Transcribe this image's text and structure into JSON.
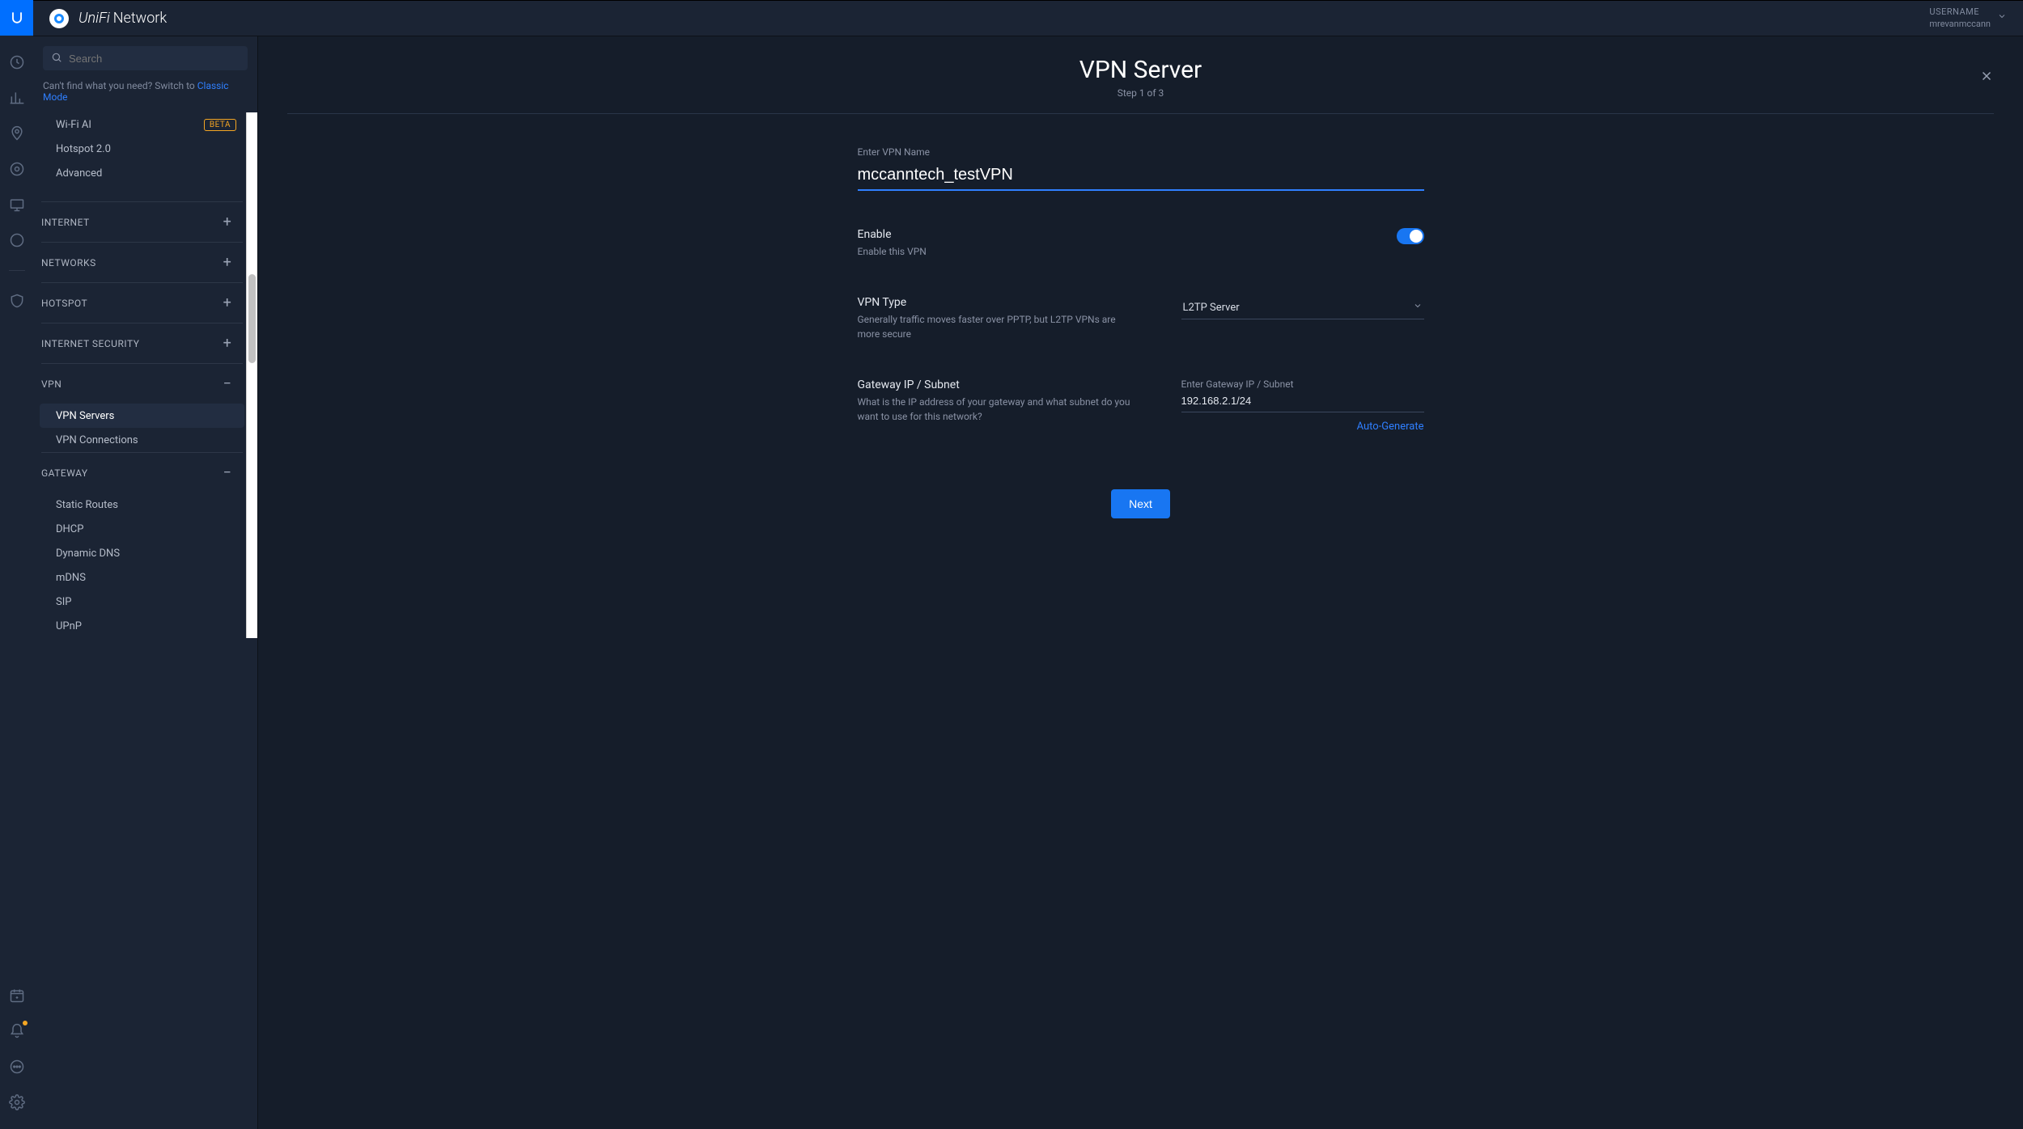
{
  "header": {
    "brand_unifi": "UniFi",
    "brand_network": "Network",
    "username_label": "USERNAME",
    "username_value": "mrevanmccann"
  },
  "sidebar": {
    "search_placeholder": "Search",
    "hint_prefix": "Can't find what you need? Switch to ",
    "hint_link": "Classic Mode",
    "top_items": [
      {
        "label": "Wi-Fi AI",
        "badge": "BETA"
      },
      {
        "label": "Hotspot 2.0"
      },
      {
        "label": "Advanced"
      }
    ],
    "sections": [
      {
        "label": "INTERNET",
        "action": "plus"
      },
      {
        "label": "NETWORKS",
        "action": "plus"
      },
      {
        "label": "HOTSPOT",
        "action": "plus"
      },
      {
        "label": "INTERNET SECURITY",
        "action": "plus"
      },
      {
        "label": "VPN",
        "action": "minus",
        "items": [
          {
            "label": "VPN Servers",
            "active": true
          },
          {
            "label": "VPN Connections"
          }
        ]
      },
      {
        "label": "GATEWAY",
        "action": "minus",
        "items": [
          {
            "label": "Static Routes"
          },
          {
            "label": "DHCP"
          },
          {
            "label": "Dynamic DNS"
          },
          {
            "label": "mDNS"
          },
          {
            "label": "SIP"
          },
          {
            "label": "UPnP"
          }
        ]
      }
    ]
  },
  "panel": {
    "title": "VPN Server",
    "step": "Step 1 of 3",
    "vpn_name_label": "Enter VPN Name",
    "vpn_name_value": "mccanntech_testVPN",
    "enable_title": "Enable",
    "enable_desc": "Enable this VPN",
    "enable_on": true,
    "type_title": "VPN Type",
    "type_desc": "Generally traffic moves faster over PPTP, but L2TP VPNs are more secure",
    "type_value": "L2TP Server",
    "gw_title": "Gateway IP / Subnet",
    "gw_desc": "What is the IP address of your gateway and what subnet do you want to use for this network?",
    "gw_label": "Enter Gateway IP / Subnet",
    "gw_value": "192.168.2.1/24",
    "autogen": "Auto-Generate",
    "next": "Next"
  }
}
